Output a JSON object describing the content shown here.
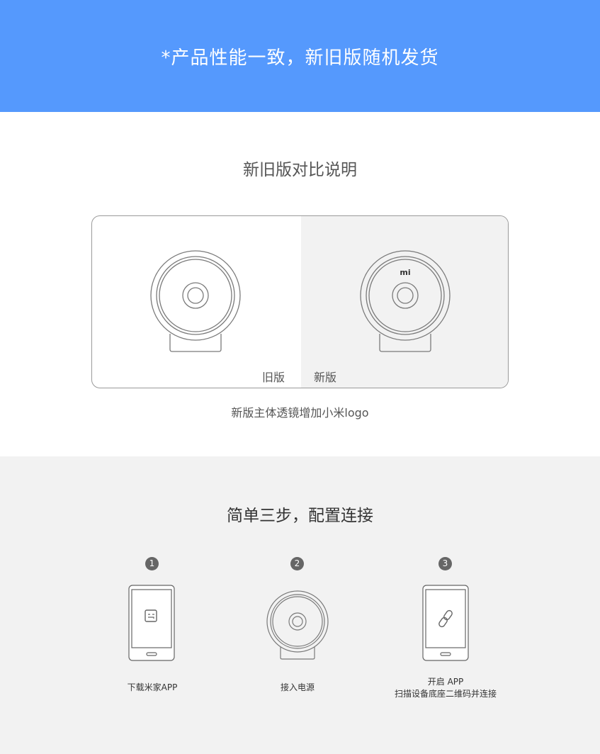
{
  "banner": {
    "text": "*产品性能一致，新旧版随机发货",
    "color": "#5599fd"
  },
  "compare": {
    "title": "新旧版对比说明",
    "old_label": "旧版",
    "new_label": "新版",
    "logo_text": "mi",
    "caption": "新版主体透镜增加小米logo"
  },
  "steps": {
    "title": "简单三步，配置连接",
    "items": [
      {
        "number": "1",
        "icon": "phone-mijia-app-icon",
        "label": "下载米家APP"
      },
      {
        "number": "2",
        "icon": "camera-power-icon",
        "label": "接入电源"
      },
      {
        "number": "3",
        "icon": "phone-link-icon",
        "label_line1": "开启 APP",
        "label_line2": "扫描设备底座二维码并连接"
      }
    ]
  }
}
